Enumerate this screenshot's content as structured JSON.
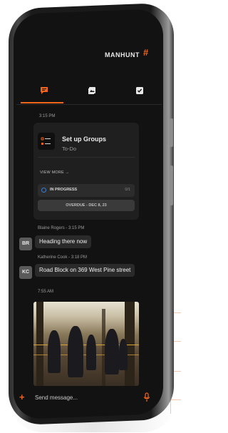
{
  "header": {
    "brand": "MANHUNT",
    "brand_symbol": "#"
  },
  "tabs": [
    {
      "name": "chat",
      "icon": "chat-bubble-icon",
      "active": true
    },
    {
      "name": "media",
      "icon": "image-gallery-icon",
      "active": false
    },
    {
      "name": "tasks",
      "icon": "checkbox-icon",
      "active": false
    }
  ],
  "messages": {
    "task_time": "3:15 PM",
    "task_card": {
      "title": "Set up Groups",
      "subtitle": "To-Do",
      "view_more": "VIEW MORE →",
      "status": "IN PROGRESS",
      "count": "0/1",
      "overdue": "OVERDUE - DEC 8, 23"
    },
    "chat": [
      {
        "sender": "Blaine Rogers - 3:15 PM",
        "initials": "BR",
        "text": "Heading there now"
      },
      {
        "sender": "Katherine Cook - 3:18 PM",
        "initials": "KC",
        "text": "Road Block on 369 West Pine street"
      }
    ],
    "photo_time": "7:55 AM"
  },
  "composer": {
    "placeholder": "Send message...",
    "plus_label": "+"
  },
  "colors": {
    "accent": "#f0651c",
    "background": "#121212",
    "bubble": "#2a2a2a"
  }
}
